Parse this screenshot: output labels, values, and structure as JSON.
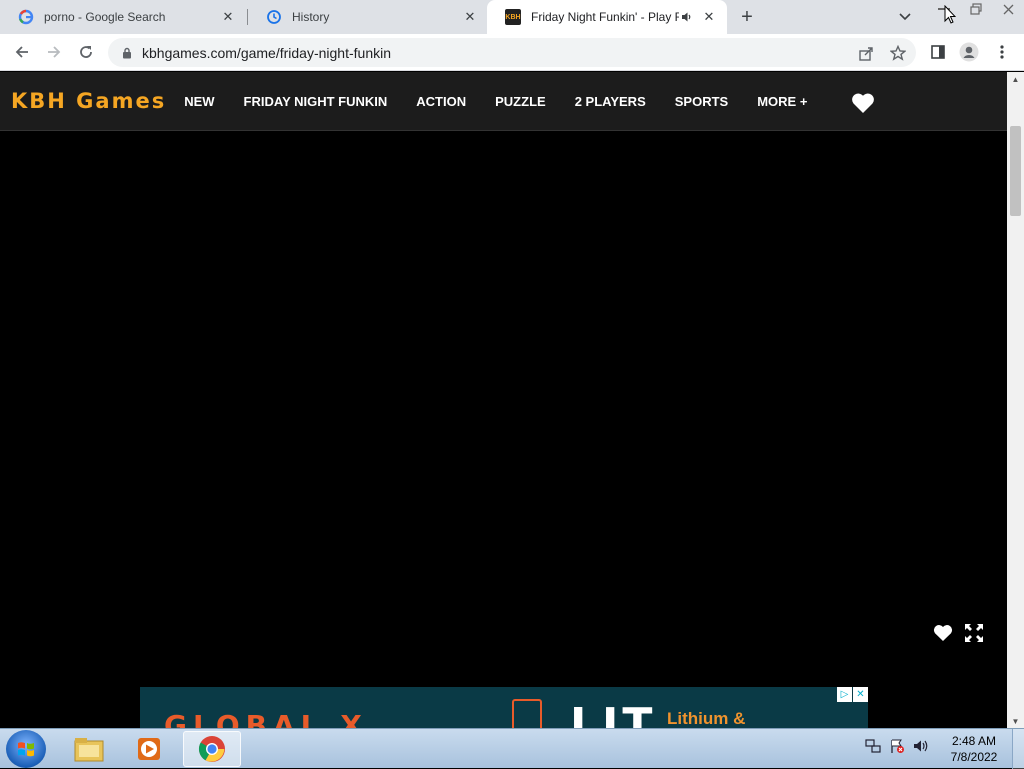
{
  "browser": {
    "tabs": [
      {
        "title": "porno - Google Search",
        "favicon": "google-icon",
        "active": false
      },
      {
        "title": "History",
        "favicon": "history-icon",
        "active": false
      },
      {
        "title": "Friday Night Funkin' - Play F",
        "favicon": "kbh-icon",
        "favicon_text": "KBH",
        "active": true,
        "audio": true
      }
    ],
    "url": "kbhgames.com/game/friday-night-funkin"
  },
  "site": {
    "logo": "KBH Games",
    "nav": [
      "NEW",
      "FRIDAY NIGHT FUNKIN",
      "ACTION",
      "PUZZLE",
      "2 PLAYERS",
      "SPORTS",
      "MORE +"
    ],
    "colors": {
      "logo": "#f5a623",
      "nav_bg": "#1c1c1c"
    }
  },
  "ad": {
    "brand": "GLOBAL X",
    "headline": "LIT",
    "subheadline": "Lithium &"
  },
  "taskbar": {
    "time": "2:48 AM",
    "date": "7/8/2022"
  }
}
